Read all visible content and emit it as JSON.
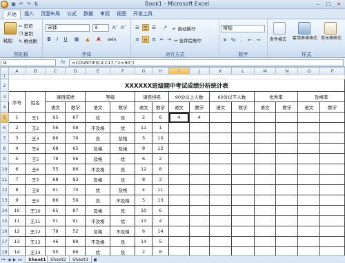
{
  "window": {
    "title": "Book1 - Microsoft Excel"
  },
  "qat": {
    "icons": [
      "save-icon",
      "undo-icon",
      "redo-icon",
      "sort-icon"
    ],
    "glyphs": [
      "▣",
      "↶",
      "↷",
      "⇅"
    ]
  },
  "tabs": [
    "开始",
    "插入",
    "页面布局",
    "公式",
    "数据",
    "审阅",
    "视图",
    "开发工具"
  ],
  "ribbon": {
    "clipboard": {
      "paste": "粘贴",
      "cut": "剪切",
      "copy": "复制",
      "format_painter": "格式刷",
      "label": "剪贴板"
    },
    "font": {
      "name": "宋体",
      "size": "9",
      "grow": "A˄",
      "shrink": "A˅",
      "bold": "B",
      "italic": "I",
      "underline": "U",
      "label": "字体",
      "wen": "wén"
    },
    "alignment": {
      "wrap": "自动换行",
      "merge": "合并后居中",
      "label": "对齐方式"
    },
    "number": {
      "format": "常规",
      "percent": "%",
      "comma": ",",
      "label": "数字"
    },
    "styles": {
      "conditional": "条件格式",
      "table": "套用表格格式",
      "cell": "单元格样式",
      "label": "样式"
    }
  },
  "formula_bar": {
    "name_box": "I4",
    "fx": "fx",
    "formula": "=COUNTIF(C4:C17,\">=90\")"
  },
  "grid": {
    "columns": [
      "A",
      "B",
      "C",
      "D",
      "E",
      "F",
      "G",
      "H",
      "I",
      "J",
      "K",
      "L",
      "M",
      "N",
      "O",
      "P"
    ],
    "title": "XXXXXX班级期中考试成绩分析统计表",
    "headers": {
      "seq": "序号",
      "name": "姓名",
      "groups": [
        "课目成绩",
        "等级",
        "课目排名",
        "90分以上人数",
        "60分以下人数",
        "优秀率",
        "及格率"
      ],
      "subs": [
        "语文",
        "数学",
        "语文",
        "数学",
        "语文",
        "数学",
        "语文",
        "数学",
        "语文",
        "数学",
        "语文",
        "数学",
        "语文",
        "数学"
      ]
    },
    "stats": [
      "4",
      "4"
    ],
    "rows": [
      [
        "1",
        "王1",
        "95",
        "87",
        "优",
        "良",
        "2",
        "6"
      ],
      [
        "2",
        "王2",
        "56",
        "98",
        "不及格",
        "优",
        "11",
        "1"
      ],
      [
        "3",
        "王3",
        "86",
        "76",
        "良",
        "及格",
        "5",
        "10"
      ],
      [
        "4",
        "王4",
        "68",
        "65",
        "及格",
        "及格",
        "8",
        "12"
      ],
      [
        "5",
        "王5",
        "78",
        "96",
        "及格",
        "优",
        "6",
        "2"
      ],
      [
        "6",
        "王6",
        "55",
        "86",
        "不及格",
        "良",
        "12",
        "8"
      ],
      [
        "7",
        "王7",
        "68",
        "93",
        "及格",
        "优",
        "8",
        "3"
      ],
      [
        "8",
        "王8",
        "91",
        "70",
        "优",
        "及格",
        "4",
        "11"
      ],
      [
        "9",
        "王9",
        "86",
        "56",
        "良",
        "不及格",
        "5",
        "13"
      ],
      [
        "10",
        "王10",
        "65",
        "87",
        "及格",
        "良",
        "10",
        "6"
      ],
      [
        "11",
        "王11",
        "51",
        "91",
        "不及格",
        "优",
        "13",
        "4"
      ],
      [
        "12",
        "王12",
        "78",
        "52",
        "及格",
        "不及格",
        "6",
        "14"
      ],
      [
        "13",
        "王13",
        "46",
        "89",
        "不及格",
        "良",
        "14",
        "5"
      ],
      [
        "14",
        "王14",
        "95",
        "86",
        "优",
        "良",
        "2",
        "8"
      ]
    ]
  },
  "sheet_tabs": {
    "nav": [
      "⏮",
      "◀",
      "▶",
      "⏭"
    ],
    "sheets": [
      "Sheet1",
      "Sheet2",
      "Sheet3"
    ],
    "active": 0
  }
}
